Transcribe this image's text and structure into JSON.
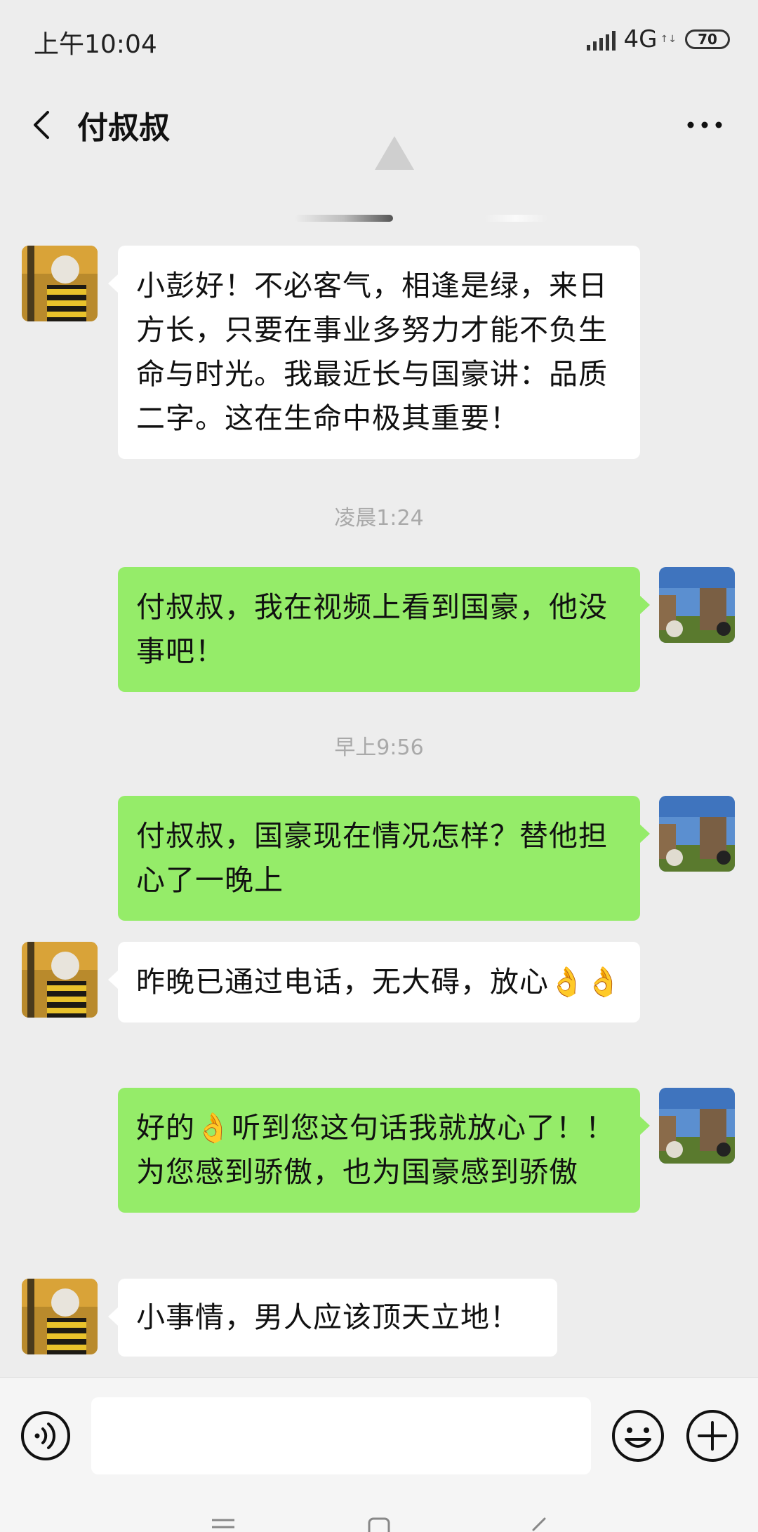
{
  "status_bar": {
    "time": "上午10:04",
    "network": "4G",
    "battery": "70"
  },
  "header": {
    "title": "付叔叔"
  },
  "messages": [
    {
      "side": "in",
      "text": "小彭好！不必客气，相逢是绿，来日方长，只要在事业多努力才能不负生命与时光。我最近长与国豪讲：品质二字。这在生命中极其重要！"
    },
    {
      "timestamp": "凌晨1:24"
    },
    {
      "side": "out",
      "text": "付叔叔，我在视频上看到国豪，他没事吧！"
    },
    {
      "timestamp": "早上9:56"
    },
    {
      "side": "out",
      "text": "付叔叔，国豪现在情况怎样？替他担心了一晚上"
    },
    {
      "side": "in",
      "text": "昨晚已通过电话，无大碍，放心👌👌"
    },
    {
      "side": "out",
      "text": "好的👌听到您这句话我就放心了！！为您感到骄傲，也为国豪感到骄傲"
    },
    {
      "side": "in",
      "text": "小事情，男人应该顶天立地！"
    }
  ],
  "input": {
    "value": ""
  },
  "icons": {
    "back": "chevron-left-icon",
    "more": "more-dots-icon",
    "voice": "voice-icon",
    "emoji": "emoji-icon",
    "plus": "plus-icon"
  },
  "colors": {
    "background": "#ededed",
    "outgoing_bubble": "#95ec69",
    "incoming_bubble": "#ffffff",
    "timestamp_text": "#a9a9a9"
  }
}
